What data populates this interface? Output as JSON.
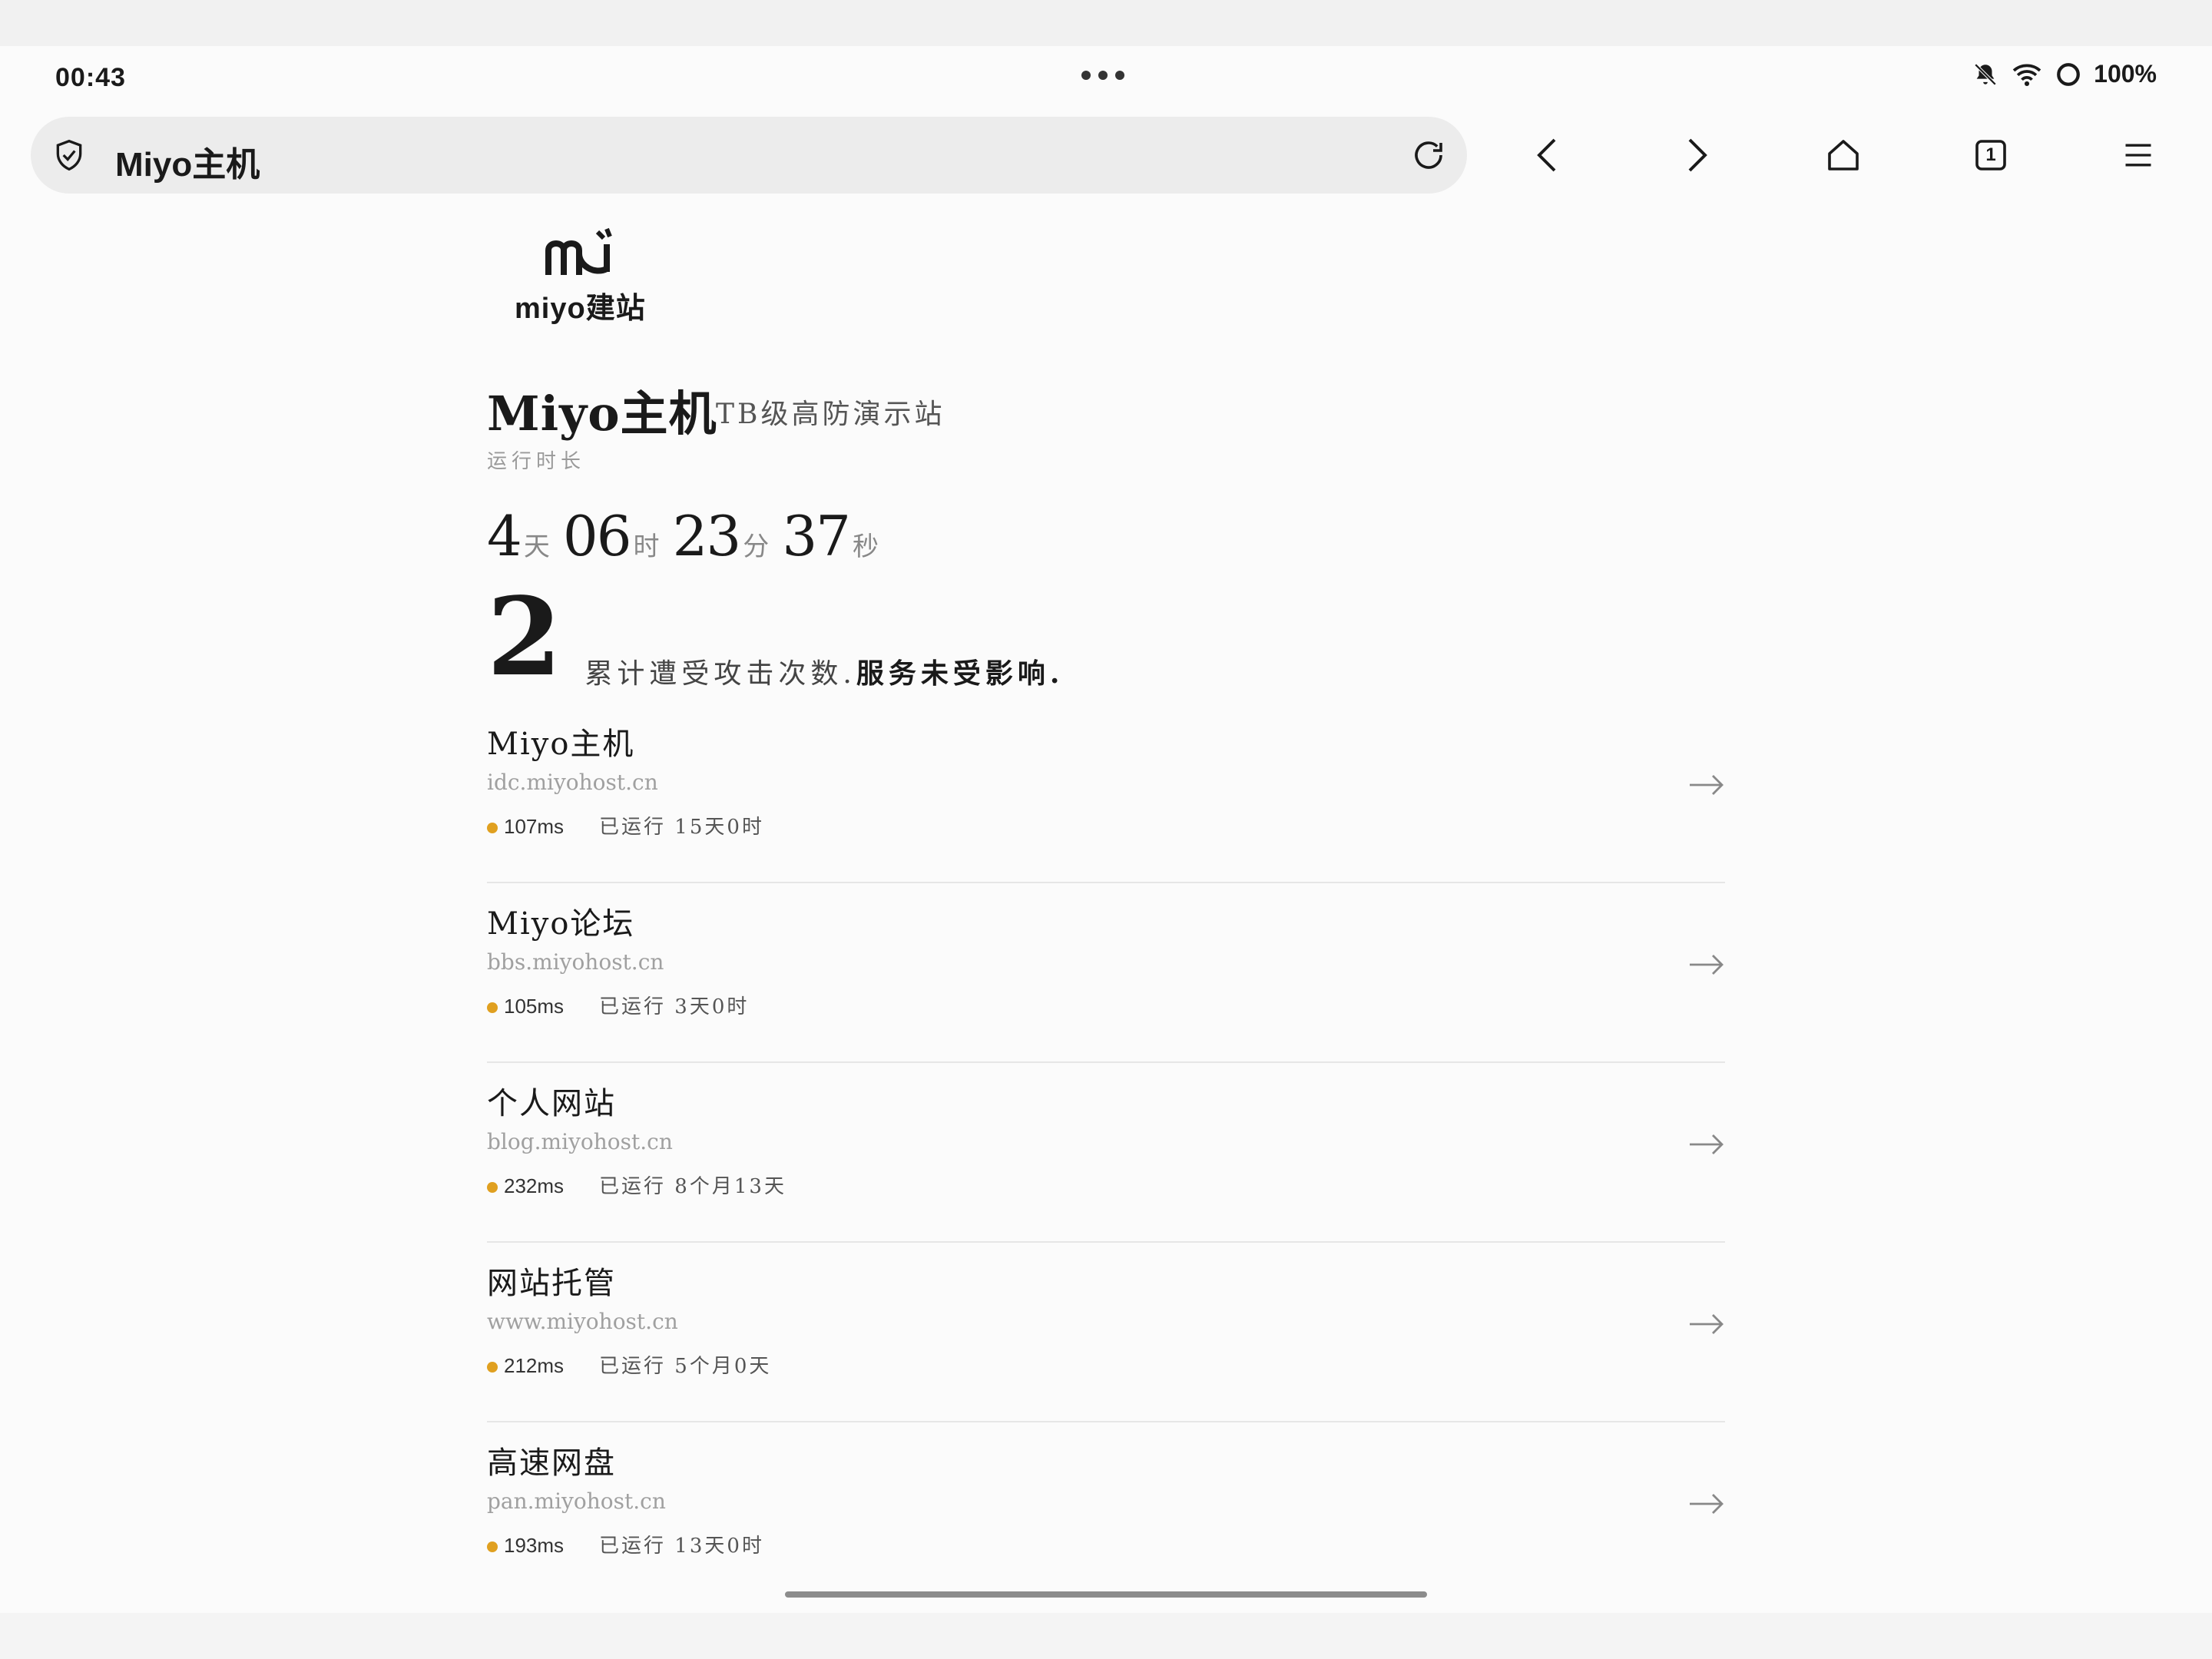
{
  "status": {
    "time": "00:43",
    "battery": "100%"
  },
  "browser": {
    "url_title": "Miyo主机",
    "tab_count": "1"
  },
  "logo": {
    "text": "miyo建站"
  },
  "hero": {
    "title": "Miyo主机",
    "subtitle": "TB级高防演示站",
    "uptime_label": "运行时长",
    "uptime": {
      "days": "4",
      "days_unit": "天",
      "hours": "06",
      "hours_unit": "时",
      "minutes": "23",
      "minutes_unit": "分",
      "seconds": "37",
      "seconds_unit": "秒"
    },
    "attack_count": "2",
    "attack_text": "累计遭受攻击次数.",
    "attack_bold": "服务未受影响."
  },
  "services": [
    {
      "name": "Miyo主机",
      "url": "idc.miyohost.cn",
      "latency": "107ms",
      "running": "已运行 15天0时"
    },
    {
      "name": "Miyo论坛",
      "url": "bbs.miyohost.cn",
      "latency": "105ms",
      "running": "已运行 3天0时"
    },
    {
      "name": "个人网站",
      "url": "blog.miyohost.cn",
      "latency": "232ms",
      "running": "已运行 8个月13天"
    },
    {
      "name": "网站托管",
      "url": "www.miyohost.cn",
      "latency": "212ms",
      "running": "已运行 5个月0天"
    },
    {
      "name": "高速网盘",
      "url": "pan.miyohost.cn",
      "latency": "193ms",
      "running": "已运行 13天0时"
    }
  ],
  "colors": {
    "status_dot": "#e0a020",
    "text": "#1a1a1a",
    "muted": "#a0a0a0"
  }
}
